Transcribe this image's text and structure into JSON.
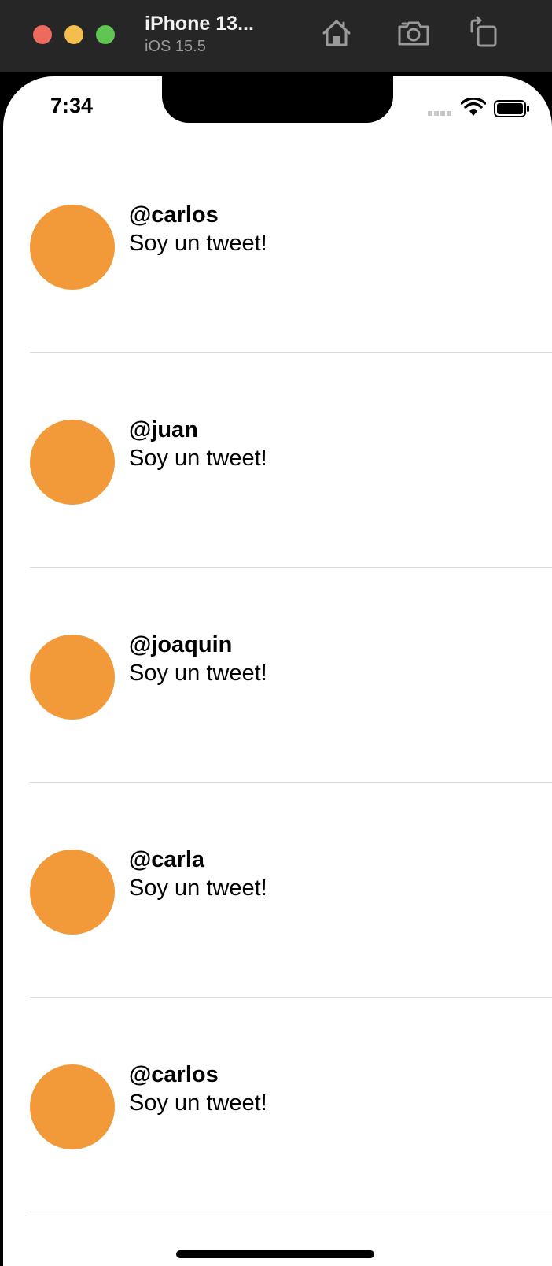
{
  "simulator": {
    "device_name": "iPhone 13...",
    "os_version": "iOS 15.5",
    "icons": [
      "home-icon",
      "screenshot-icon",
      "rotate-icon"
    ]
  },
  "status_bar": {
    "time": "7:34",
    "icons": [
      "cellular-signal-icon",
      "wifi-icon",
      "battery-icon"
    ]
  },
  "colors": {
    "avatar": "#f29a3a",
    "traffic_close": "#ed6a5e",
    "traffic_minimize": "#f4be4f",
    "traffic_zoom": "#61c554"
  },
  "tweets": [
    {
      "handle": "@carlos",
      "text": "Soy un tweet!"
    },
    {
      "handle": "@juan",
      "text": "Soy un tweet!"
    },
    {
      "handle": "@joaquin",
      "text": "Soy un tweet!"
    },
    {
      "handle": "@carla",
      "text": "Soy un tweet!"
    },
    {
      "handle": "@carlos",
      "text": "Soy un tweet!"
    }
  ]
}
